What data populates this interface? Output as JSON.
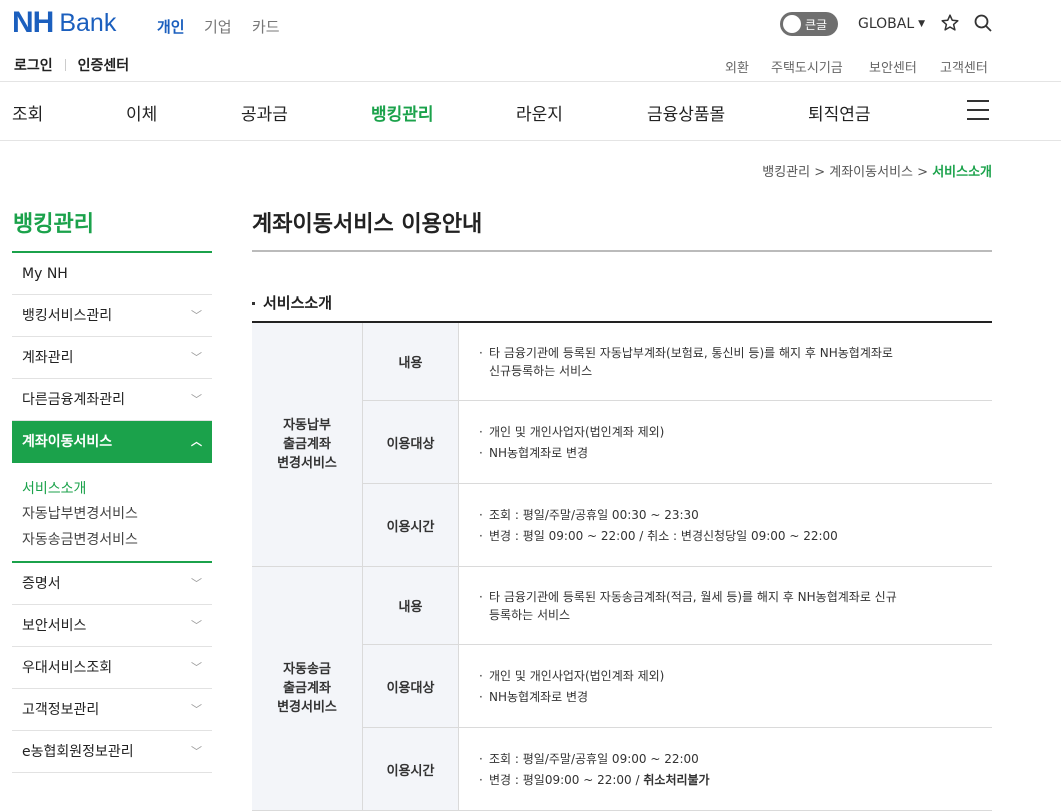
{
  "header": {
    "logo_nh": "NH",
    "logo_bank": "Bank",
    "sectors": [
      "개인",
      "기업",
      "카드"
    ],
    "toggle_label": "큰글",
    "global_label": "GLOBAL",
    "util_left": [
      "로그인",
      "인증센터"
    ],
    "util_right": [
      "외환",
      "주택도시기금",
      "보안센터",
      "고객센터"
    ]
  },
  "gnb": {
    "items": [
      "조회",
      "이체",
      "공과금",
      "뱅킹관리",
      "라운지",
      "금융상품몰",
      "퇴직연금"
    ],
    "active": "뱅킹관리"
  },
  "breadcrumb": {
    "items": [
      "뱅킹관리",
      "계좌이동서비스"
    ],
    "current": "서비스소개",
    "separator": ">"
  },
  "lnb": {
    "title": "뱅킹관리",
    "items": [
      "My NH",
      "뱅킹서비스관리",
      "계좌관리",
      "다른금융계좌관리",
      "계좌이동서비스",
      "증명서",
      "보안서비스",
      "우대서비스조회",
      "고객정보관리",
      "e농협회원정보관리"
    ],
    "active": "계좌이동서비스",
    "subitems": [
      "서비스소개",
      "자동납부변경서비스",
      "자동송금변경서비스"
    ],
    "active_sub": "서비스소개"
  },
  "content": {
    "page_title": "계좌이동서비스 이용안내",
    "section_title": "서비스소개",
    "groups": [
      {
        "name_lines": [
          "자동납부",
          "출금계좌",
          "변경서비스"
        ],
        "rows": [
          {
            "head": "내용",
            "lines": [
              "타 금융기관에 등록된 자동납부계좌(보험료, 통신비 등)를 해지 후 NH농협계좌로",
              "신규등록하는 서비스"
            ]
          },
          {
            "head": "이용대상",
            "lines": [
              "개인 및 개인사업자(법인계좌 제외)",
              "NH농협계좌로 변경"
            ]
          },
          {
            "head": "이용시간",
            "lines": [
              "조회 : 평일/주말/공휴일 00:30 ~ 23:30",
              "변경 : 평일 09:00 ~ 22:00 / 취소 : 변경신청당일 09:00 ~ 22:00"
            ]
          }
        ]
      },
      {
        "name_lines": [
          "자동송금",
          "출금계좌",
          "변경서비스"
        ],
        "rows": [
          {
            "head": "내용",
            "lines": [
              "타 금융기관에 등록된 자동송금계좌(적금, 월세 등)를 해지 후 NH농협계좌로 신규",
              "등록하는 서비스"
            ]
          },
          {
            "head": "이용대상",
            "lines": [
              "개인 및 개인사업자(법인계좌 제외)",
              "NH농협계좌로 변경"
            ]
          },
          {
            "head": "이용시간",
            "lines": [
              "조회 : 평일/주말/공휴일 09:00 ~ 22:00",
              "변경 : 평일09:00 ~ 22:00 / "
            ],
            "strong_suffix": "취소처리불가"
          }
        ]
      }
    ]
  },
  "colors": {
    "brand_blue": "#1b5fbe",
    "brand_green": "#1ba24b"
  },
  "icons": [
    "star-icon",
    "search-icon",
    "hamburger-icon",
    "chevron-down-icon",
    "chevron-up-icon",
    "caret-down-icon"
  ]
}
